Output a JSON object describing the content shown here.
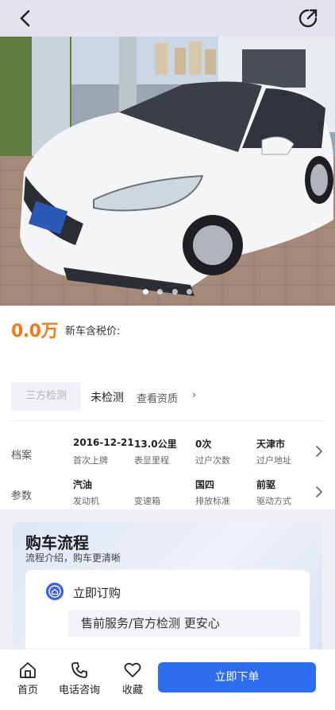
{
  "topbar": {
    "back_icon": "back-arrow-icon",
    "share_icon": "share-icon"
  },
  "gallery": {
    "image_count": 4,
    "active_index": 0
  },
  "price": {
    "value": "0.0万",
    "new_car_label": "新车含税价:"
  },
  "inspection": {
    "badge": "三方检测",
    "status": "未检测",
    "qualification_link": "查看资质",
    "arrow": "›"
  },
  "file": {
    "label": "档案",
    "cells": [
      {
        "value": "2016-12-21",
        "key": "首次上牌"
      },
      {
        "value": "13.0公里",
        "key": "表显里程"
      },
      {
        "value": "0次",
        "key": "过户次数"
      },
      {
        "value": "天津市",
        "key": "过户地址"
      }
    ]
  },
  "params": {
    "label": "参数",
    "cells": [
      {
        "value": "汽油",
        "key": "发动机"
      },
      {
        "value": "",
        "key": "变速箱"
      },
      {
        "value": "国四",
        "key": "排放标准"
      },
      {
        "value": "前驱",
        "key": "驱动方式"
      }
    ]
  },
  "process": {
    "title": "购车流程",
    "subtitle": "流程介绍，购车更清晰",
    "step_title": "立即订购",
    "step_desc": "售前服务/官方检测 更安心"
  },
  "bottom": {
    "home": "首页",
    "phone": "电话咨询",
    "favorite": "收藏",
    "order": "立即下单"
  },
  "colors": {
    "accent": "#2d6ef0",
    "price": "#f07a1c"
  }
}
